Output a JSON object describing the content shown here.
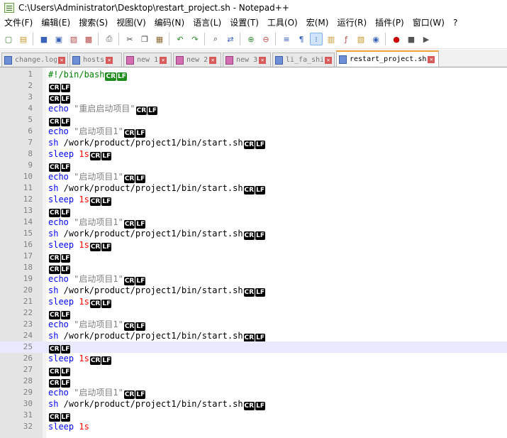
{
  "window": {
    "title": "C:\\Users\\Administrator\\Desktop\\restart_project.sh - Notepad++"
  },
  "menu": [
    "文件(F)",
    "编辑(E)",
    "搜索(S)",
    "视图(V)",
    "编码(N)",
    "语言(L)",
    "设置(T)",
    "工具(O)",
    "宏(M)",
    "运行(R)",
    "插件(P)",
    "窗口(W)",
    "?"
  ],
  "toolbar": {
    "buttons": [
      {
        "name": "new-file-icon",
        "glyph": "▢",
        "color": "#3b7d2b"
      },
      {
        "name": "open-file-icon",
        "glyph": "▤",
        "color": "#c9962a"
      },
      {
        "name": "save-icon",
        "glyph": "■",
        "color": "#3a62b8"
      },
      {
        "name": "save-all-icon",
        "glyph": "▣",
        "color": "#3a62b8"
      },
      {
        "name": "close-file-icon",
        "glyph": "▨",
        "color": "#b84a4a"
      },
      {
        "name": "close-all-icon",
        "glyph": "▩",
        "color": "#b84a4a"
      },
      {
        "name": "print-icon",
        "glyph": "⎙",
        "color": "#555555"
      },
      {
        "name": "cut-icon",
        "glyph": "✂",
        "color": "#444444"
      },
      {
        "name": "copy-icon",
        "glyph": "❐",
        "color": "#444444"
      },
      {
        "name": "paste-icon",
        "glyph": "▦",
        "color": "#8a6a30"
      },
      {
        "name": "undo-icon",
        "glyph": "↶",
        "color": "#2a8a2a"
      },
      {
        "name": "redo-icon",
        "glyph": "↷",
        "color": "#2a8a2a"
      },
      {
        "name": "find-icon",
        "glyph": "⌕",
        "color": "#333333"
      },
      {
        "name": "replace-icon",
        "glyph": "⇄",
        "color": "#3a62b8"
      },
      {
        "name": "zoom-in-icon",
        "glyph": "⊕",
        "color": "#3a8a3a"
      },
      {
        "name": "zoom-out-icon",
        "glyph": "⊖",
        "color": "#b84a4a"
      },
      {
        "name": "word-wrap-icon",
        "glyph": "≡",
        "color": "#3a62b8"
      },
      {
        "name": "show-all-chars-icon",
        "glyph": "¶",
        "color": "#3a62b8"
      },
      {
        "name": "indent-guide-icon",
        "glyph": "⁝",
        "color": "#3a62b8",
        "active": true
      },
      {
        "name": "doc-map-icon",
        "glyph": "▥",
        "color": "#c9962a"
      },
      {
        "name": "function-list-icon",
        "glyph": "ƒ",
        "color": "#b84a4a"
      },
      {
        "name": "folder-workspace-icon",
        "glyph": "▧",
        "color": "#c9962a"
      },
      {
        "name": "monitor-icon",
        "glyph": "◉",
        "color": "#3a62b8"
      },
      {
        "name": "record-macro-icon",
        "glyph": "●",
        "color": "#cc0000"
      },
      {
        "name": "stop-macro-icon",
        "glyph": "■",
        "color": "#555555"
      },
      {
        "name": "play-macro-icon",
        "glyph": "▶",
        "color": "#555555"
      }
    ]
  },
  "tabs": [
    {
      "label": "change.log",
      "modified": false,
      "active": false
    },
    {
      "label": "hosts",
      "modified": false,
      "active": false
    },
    {
      "label": "new 1",
      "modified": true,
      "active": false
    },
    {
      "label": "new 2",
      "modified": true,
      "active": false
    },
    {
      "label": "new 3",
      "modified": true,
      "active": false
    },
    {
      "label": "li_fa_shi.sh",
      "modified": false,
      "active": false
    },
    {
      "label": "restart_project.sh",
      "modified": false,
      "active": true
    }
  ],
  "editor": {
    "current_line": 25,
    "eol_cr": "CR",
    "eol_lf": "LF",
    "lines": [
      {
        "n": "1",
        "tokens": [
          {
            "c": "comment",
            "t": "#!/bin/bash"
          }
        ],
        "eol": "green"
      },
      {
        "n": "2",
        "tokens": [],
        "eol": "crlf"
      },
      {
        "n": "3",
        "tokens": [],
        "eol": "crlf"
      },
      {
        "n": "4",
        "tokens": [
          {
            "c": "kw",
            "t": "echo"
          },
          {
            "c": "txt",
            "t": " "
          },
          {
            "c": "str",
            "t": "\"重启启动项目\""
          }
        ],
        "eol": "crlf"
      },
      {
        "n": "5",
        "tokens": [],
        "eol": "crlf"
      },
      {
        "n": "6",
        "tokens": [
          {
            "c": "kw",
            "t": "echo"
          },
          {
            "c": "txt",
            "t": " "
          },
          {
            "c": "str",
            "t": "\"启动项目1\""
          }
        ],
        "eol": "crlf"
      },
      {
        "n": "7",
        "tokens": [
          {
            "c": "kw",
            "t": "sh"
          },
          {
            "c": "txt",
            "t": " /work/product/project1/bin/start.sh"
          }
        ],
        "eol": "crlf"
      },
      {
        "n": "8",
        "tokens": [
          {
            "c": "kw",
            "t": "sleep"
          },
          {
            "c": "txt",
            "t": " "
          },
          {
            "c": "num",
            "t": "1s"
          }
        ],
        "eol": "crlf"
      },
      {
        "n": "9",
        "tokens": [],
        "eol": "crlf"
      },
      {
        "n": "10",
        "tokens": [
          {
            "c": "kw",
            "t": "echo"
          },
          {
            "c": "txt",
            "t": " "
          },
          {
            "c": "str",
            "t": "\"启动项目1\""
          }
        ],
        "eol": "crlf"
      },
      {
        "n": "11",
        "tokens": [
          {
            "c": "kw",
            "t": "sh"
          },
          {
            "c": "txt",
            "t": " /work/product/project1/bin/start.sh"
          }
        ],
        "eol": "crlf"
      },
      {
        "n": "12",
        "tokens": [
          {
            "c": "kw",
            "t": "sleep"
          },
          {
            "c": "txt",
            "t": " "
          },
          {
            "c": "num",
            "t": "1s"
          }
        ],
        "eol": "crlf"
      },
      {
        "n": "13",
        "tokens": [],
        "eol": "crlf"
      },
      {
        "n": "14",
        "tokens": [
          {
            "c": "kw",
            "t": "echo"
          },
          {
            "c": "txt",
            "t": " "
          },
          {
            "c": "str",
            "t": "\"启动项目1\""
          }
        ],
        "eol": "crlf"
      },
      {
        "n": "15",
        "tokens": [
          {
            "c": "kw",
            "t": "sh"
          },
          {
            "c": "txt",
            "t": " /work/product/project1/bin/start.sh"
          }
        ],
        "eol": "crlf"
      },
      {
        "n": "16",
        "tokens": [
          {
            "c": "kw",
            "t": "sleep"
          },
          {
            "c": "txt",
            "t": " "
          },
          {
            "c": "num",
            "t": "1s"
          }
        ],
        "eol": "crlf"
      },
      {
        "n": "17",
        "tokens": [],
        "eol": "crlf"
      },
      {
        "n": "18",
        "tokens": [],
        "eol": "crlf"
      },
      {
        "n": "19",
        "tokens": [
          {
            "c": "kw",
            "t": "echo"
          },
          {
            "c": "txt",
            "t": " "
          },
          {
            "c": "str",
            "t": "\"启动项目1\""
          }
        ],
        "eol": "crlf"
      },
      {
        "n": "20",
        "tokens": [
          {
            "c": "kw",
            "t": "sh"
          },
          {
            "c": "txt",
            "t": " /work/product/project1/bin/start.sh"
          }
        ],
        "eol": "crlf"
      },
      {
        "n": "21",
        "tokens": [
          {
            "c": "kw",
            "t": "sleep"
          },
          {
            "c": "txt",
            "t": " "
          },
          {
            "c": "num",
            "t": "1s"
          }
        ],
        "eol": "crlf"
      },
      {
        "n": "22",
        "tokens": [],
        "eol": "crlf"
      },
      {
        "n": "23",
        "tokens": [
          {
            "c": "kw",
            "t": "echo"
          },
          {
            "c": "txt",
            "t": " "
          },
          {
            "c": "str",
            "t": "\"启动项目1\""
          }
        ],
        "eol": "crlf"
      },
      {
        "n": "24",
        "tokens": [
          {
            "c": "kw",
            "t": "sh"
          },
          {
            "c": "txt",
            "t": " /work/product/project1/bin/start.sh"
          }
        ],
        "eol": "crlf"
      },
      {
        "n": "25",
        "tokens": [],
        "eol": "crlf"
      },
      {
        "n": "26",
        "tokens": [
          {
            "c": "kw",
            "t": "sleep"
          },
          {
            "c": "txt",
            "t": " "
          },
          {
            "c": "num",
            "t": "1s"
          }
        ],
        "eol": "crlf"
      },
      {
        "n": "27",
        "tokens": [],
        "eol": "crlf"
      },
      {
        "n": "28",
        "tokens": [],
        "eol": "crlf"
      },
      {
        "n": "29",
        "tokens": [
          {
            "c": "kw",
            "t": "echo"
          },
          {
            "c": "txt",
            "t": " "
          },
          {
            "c": "str",
            "t": "\"启动项目1\""
          }
        ],
        "eol": "crlf"
      },
      {
        "n": "30",
        "tokens": [
          {
            "c": "kw",
            "t": "sh"
          },
          {
            "c": "txt",
            "t": " /work/product/project1/bin/start.sh"
          }
        ],
        "eol": "crlf"
      },
      {
        "n": "31",
        "tokens": [],
        "eol": "crlf"
      },
      {
        "n": "32",
        "tokens": [
          {
            "c": "kw",
            "t": "sleep"
          },
          {
            "c": "txt",
            "t": " "
          },
          {
            "c": "num",
            "t": "1s"
          }
        ],
        "eol": "none"
      }
    ]
  }
}
